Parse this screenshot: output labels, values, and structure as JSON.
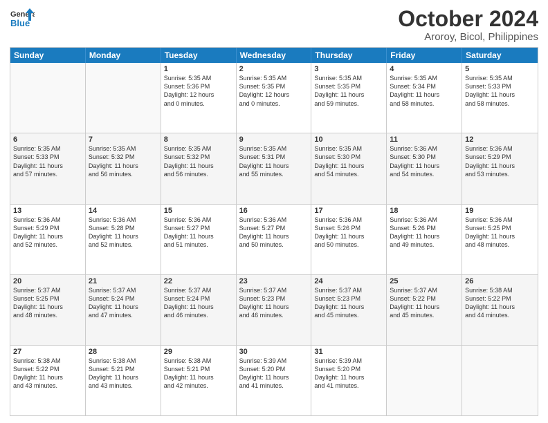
{
  "logo": {
    "line1": "General",
    "line2": "Blue"
  },
  "title": "October 2024",
  "subtitle": "Aroroy, Bicol, Philippines",
  "days": [
    "Sunday",
    "Monday",
    "Tuesday",
    "Wednesday",
    "Thursday",
    "Friday",
    "Saturday"
  ],
  "weeks": [
    [
      {
        "day": "",
        "info": ""
      },
      {
        "day": "",
        "info": ""
      },
      {
        "day": "1",
        "info": "Sunrise: 5:35 AM\nSunset: 5:36 PM\nDaylight: 12 hours\nand 0 minutes."
      },
      {
        "day": "2",
        "info": "Sunrise: 5:35 AM\nSunset: 5:35 PM\nDaylight: 12 hours\nand 0 minutes."
      },
      {
        "day": "3",
        "info": "Sunrise: 5:35 AM\nSunset: 5:35 PM\nDaylight: 11 hours\nand 59 minutes."
      },
      {
        "day": "4",
        "info": "Sunrise: 5:35 AM\nSunset: 5:34 PM\nDaylight: 11 hours\nand 58 minutes."
      },
      {
        "day": "5",
        "info": "Sunrise: 5:35 AM\nSunset: 5:33 PM\nDaylight: 11 hours\nand 58 minutes."
      }
    ],
    [
      {
        "day": "6",
        "info": "Sunrise: 5:35 AM\nSunset: 5:33 PM\nDaylight: 11 hours\nand 57 minutes."
      },
      {
        "day": "7",
        "info": "Sunrise: 5:35 AM\nSunset: 5:32 PM\nDaylight: 11 hours\nand 56 minutes."
      },
      {
        "day": "8",
        "info": "Sunrise: 5:35 AM\nSunset: 5:32 PM\nDaylight: 11 hours\nand 56 minutes."
      },
      {
        "day": "9",
        "info": "Sunrise: 5:35 AM\nSunset: 5:31 PM\nDaylight: 11 hours\nand 55 minutes."
      },
      {
        "day": "10",
        "info": "Sunrise: 5:35 AM\nSunset: 5:30 PM\nDaylight: 11 hours\nand 54 minutes."
      },
      {
        "day": "11",
        "info": "Sunrise: 5:36 AM\nSunset: 5:30 PM\nDaylight: 11 hours\nand 54 minutes."
      },
      {
        "day": "12",
        "info": "Sunrise: 5:36 AM\nSunset: 5:29 PM\nDaylight: 11 hours\nand 53 minutes."
      }
    ],
    [
      {
        "day": "13",
        "info": "Sunrise: 5:36 AM\nSunset: 5:29 PM\nDaylight: 11 hours\nand 52 minutes."
      },
      {
        "day": "14",
        "info": "Sunrise: 5:36 AM\nSunset: 5:28 PM\nDaylight: 11 hours\nand 52 minutes."
      },
      {
        "day": "15",
        "info": "Sunrise: 5:36 AM\nSunset: 5:27 PM\nDaylight: 11 hours\nand 51 minutes."
      },
      {
        "day": "16",
        "info": "Sunrise: 5:36 AM\nSunset: 5:27 PM\nDaylight: 11 hours\nand 50 minutes."
      },
      {
        "day": "17",
        "info": "Sunrise: 5:36 AM\nSunset: 5:26 PM\nDaylight: 11 hours\nand 50 minutes."
      },
      {
        "day": "18",
        "info": "Sunrise: 5:36 AM\nSunset: 5:26 PM\nDaylight: 11 hours\nand 49 minutes."
      },
      {
        "day": "19",
        "info": "Sunrise: 5:36 AM\nSunset: 5:25 PM\nDaylight: 11 hours\nand 48 minutes."
      }
    ],
    [
      {
        "day": "20",
        "info": "Sunrise: 5:37 AM\nSunset: 5:25 PM\nDaylight: 11 hours\nand 48 minutes."
      },
      {
        "day": "21",
        "info": "Sunrise: 5:37 AM\nSunset: 5:24 PM\nDaylight: 11 hours\nand 47 minutes."
      },
      {
        "day": "22",
        "info": "Sunrise: 5:37 AM\nSunset: 5:24 PM\nDaylight: 11 hours\nand 46 minutes."
      },
      {
        "day": "23",
        "info": "Sunrise: 5:37 AM\nSunset: 5:23 PM\nDaylight: 11 hours\nand 46 minutes."
      },
      {
        "day": "24",
        "info": "Sunrise: 5:37 AM\nSunset: 5:23 PM\nDaylight: 11 hours\nand 45 minutes."
      },
      {
        "day": "25",
        "info": "Sunrise: 5:37 AM\nSunset: 5:22 PM\nDaylight: 11 hours\nand 45 minutes."
      },
      {
        "day": "26",
        "info": "Sunrise: 5:38 AM\nSunset: 5:22 PM\nDaylight: 11 hours\nand 44 minutes."
      }
    ],
    [
      {
        "day": "27",
        "info": "Sunrise: 5:38 AM\nSunset: 5:22 PM\nDaylight: 11 hours\nand 43 minutes."
      },
      {
        "day": "28",
        "info": "Sunrise: 5:38 AM\nSunset: 5:21 PM\nDaylight: 11 hours\nand 43 minutes."
      },
      {
        "day": "29",
        "info": "Sunrise: 5:38 AM\nSunset: 5:21 PM\nDaylight: 11 hours\nand 42 minutes."
      },
      {
        "day": "30",
        "info": "Sunrise: 5:39 AM\nSunset: 5:20 PM\nDaylight: 11 hours\nand 41 minutes."
      },
      {
        "day": "31",
        "info": "Sunrise: 5:39 AM\nSunset: 5:20 PM\nDaylight: 11 hours\nand 41 minutes."
      },
      {
        "day": "",
        "info": ""
      },
      {
        "day": "",
        "info": ""
      }
    ]
  ]
}
